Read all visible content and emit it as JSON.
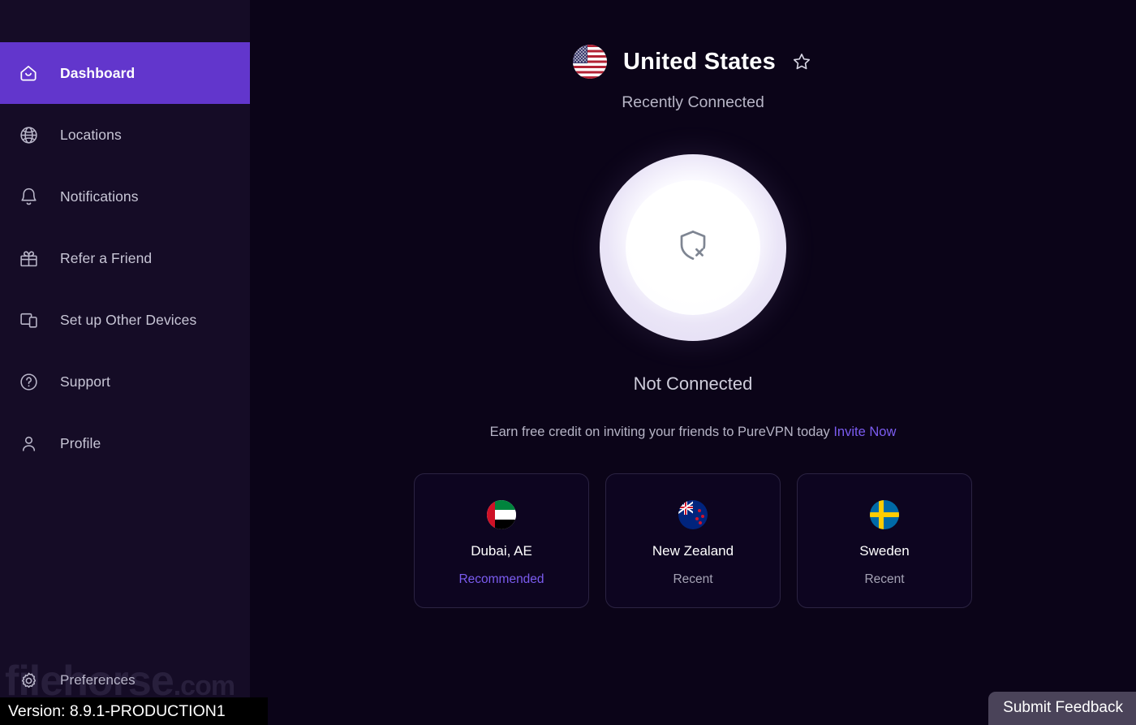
{
  "sidebar": {
    "items": [
      {
        "label": "Dashboard",
        "icon": "home-icon",
        "active": true
      },
      {
        "label": "Locations",
        "icon": "globe-icon",
        "active": false
      },
      {
        "label": "Notifications",
        "icon": "bell-icon",
        "active": false
      },
      {
        "label": "Refer a Friend",
        "icon": "gift-icon",
        "active": false
      },
      {
        "label": "Set up Other Devices",
        "icon": "devices-icon",
        "active": false
      },
      {
        "label": "Support",
        "icon": "help-icon",
        "active": false
      },
      {
        "label": "Profile",
        "icon": "user-icon",
        "active": false
      }
    ],
    "preferences": {
      "label": "Preferences",
      "icon": "gear-icon"
    },
    "version": "Version: 8.9.1-PRODUCTION1",
    "watermark": {
      "name": "filehorse",
      "domain": ".com"
    }
  },
  "header": {
    "country": "United States",
    "flag": "us-flag",
    "favorite_icon": "star-icon",
    "subtitle": "Recently Connected"
  },
  "connect": {
    "icon": "shield-off-icon",
    "status": "Not Connected"
  },
  "invite": {
    "text": "Earn free credit on inviting your friends to PureVPN today",
    "link_label": "Invite Now"
  },
  "locations": {
    "cards": [
      {
        "name": "Dubai, AE",
        "tag": "Recommended",
        "tag_type": "recommended",
        "flag": "ae-flag"
      },
      {
        "name": "New Zealand",
        "tag": "Recent",
        "tag_type": "recent",
        "flag": "nz-flag"
      },
      {
        "name": "Sweden",
        "tag": "Recent",
        "tag_type": "recent",
        "flag": "se-flag"
      }
    ]
  },
  "feedback": {
    "label": "Submit Feedback"
  },
  "colors": {
    "accent_purple": "#6236cc",
    "link_purple": "#7b5cf0",
    "sidebar_bg": "#150c26",
    "main_bg": "#0b0418",
    "card_border": "#2b2342"
  }
}
